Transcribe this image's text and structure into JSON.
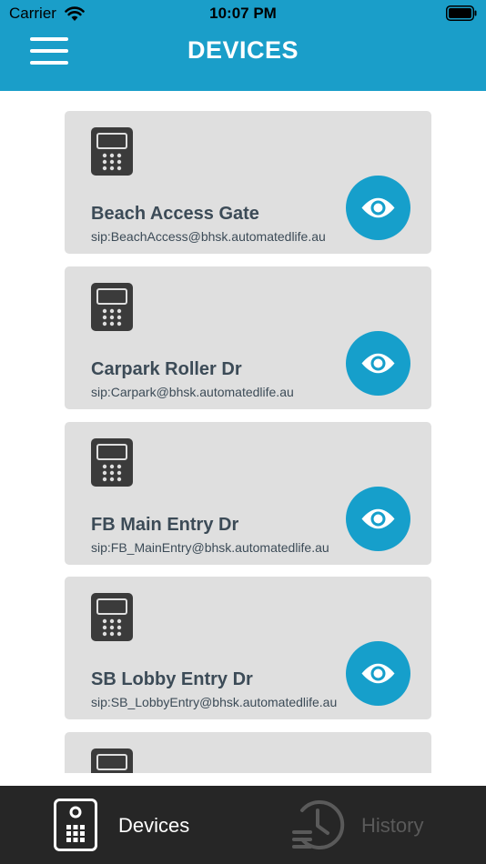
{
  "status_bar": {
    "carrier": "Carrier",
    "time": "10:07 PM"
  },
  "header": {
    "title": "DEVICES",
    "menu_icon": "hamburger-menu-icon",
    "background_color": "#1a9ec9"
  },
  "devices": [
    {
      "name": "Beach Access Gate",
      "sip": "sip:BeachAccess@bhsk.automatedlife.au"
    },
    {
      "name": "Carpark Roller Dr",
      "sip": "sip:Carpark@bhsk.automatedlife.au"
    },
    {
      "name": "FB Main Entry Dr",
      "sip": "sip:FB_MainEntry@bhsk.automatedlife.au"
    },
    {
      "name": "SB Lobby Entry Dr",
      "sip": "sip:SB_LobbyEntry@bhsk.automatedlife.au"
    },
    {
      "name": "",
      "sip": ""
    }
  ],
  "colors": {
    "accent": "#169fcb",
    "card_background": "#dfdfdf",
    "text_dark": "#3c4b57",
    "tabbar_background": "#262626"
  },
  "tabbar": {
    "tabs": [
      {
        "label": "Devices",
        "icon": "intercom-icon",
        "active": true
      },
      {
        "label": "History",
        "icon": "history-clock-icon",
        "active": false
      }
    ]
  }
}
